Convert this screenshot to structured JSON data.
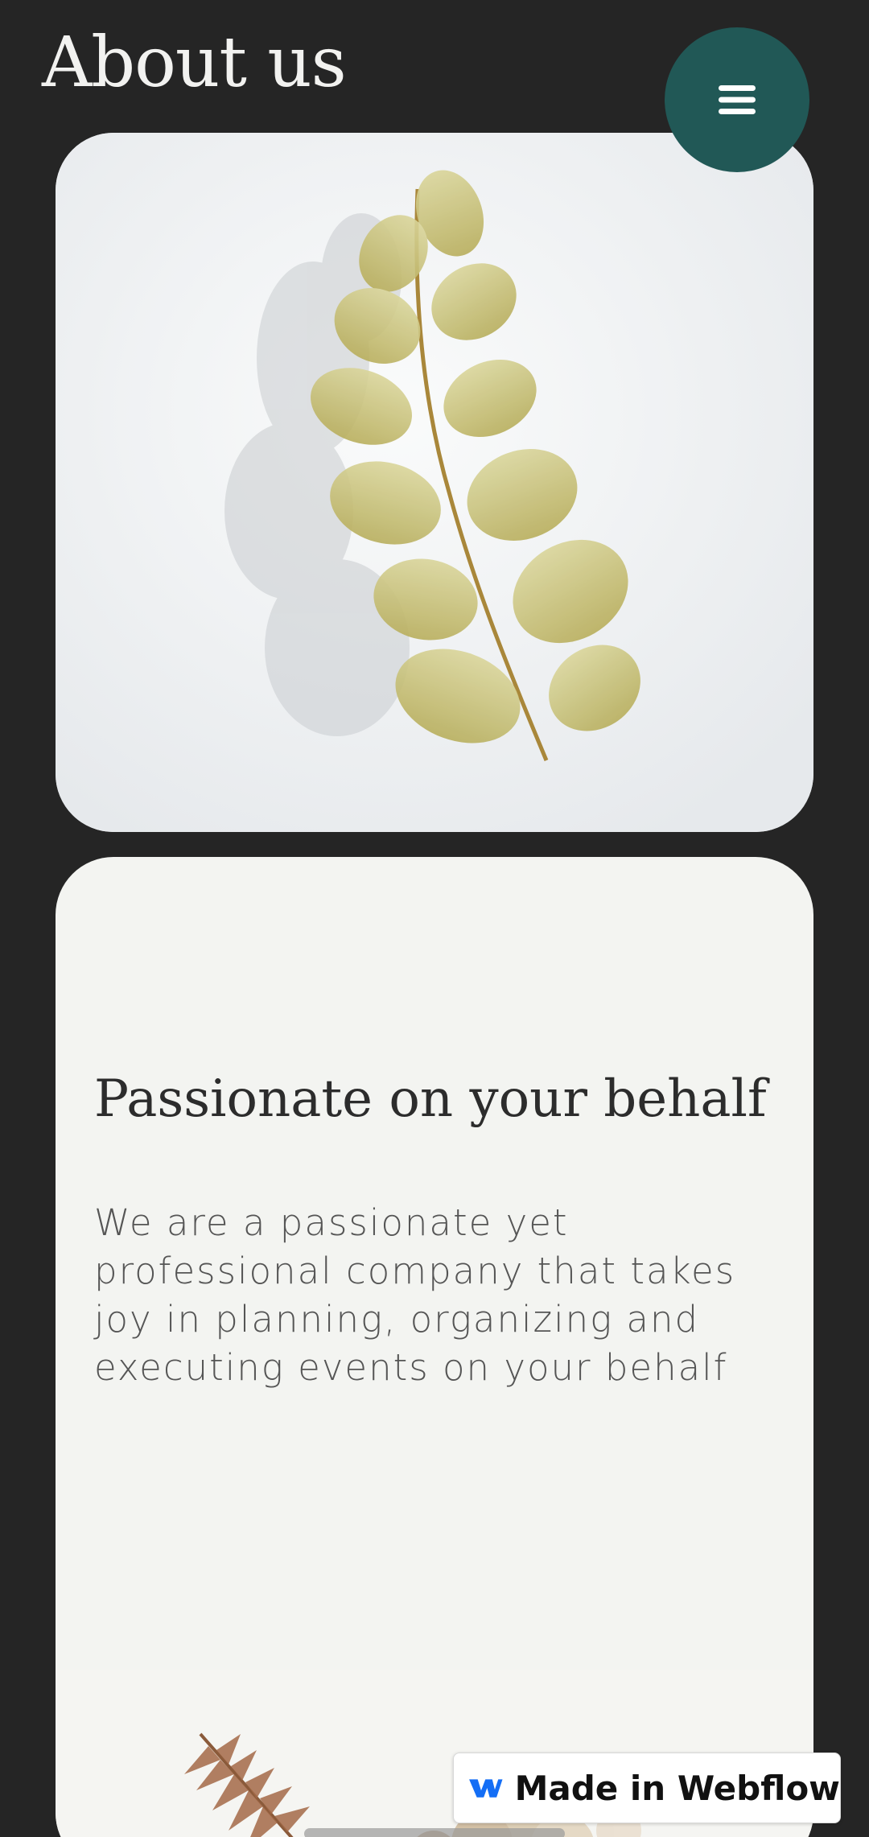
{
  "header": {
    "title": "About us",
    "menu_icon": "hamburger-menu-icon"
  },
  "hero_image": {
    "subject": "fern-leaf-on-white"
  },
  "info_card": {
    "heading": "Passionate on your behalf",
    "body_lines": [
      "We are a passionate yet",
      "professional company that takes",
      "joy in planning, organizing and",
      "executing events on your behalf"
    ],
    "image_subject": "dried-flowers"
  },
  "badge": {
    "label": "Made in Webflow",
    "logo": "webflow-logo-icon"
  },
  "colors": {
    "page_background": "#252525",
    "menu_button": "#215856",
    "card_background": "#f3f4f1",
    "title_text": "#f2f2f0",
    "webflow_blue": "#146ef5"
  }
}
